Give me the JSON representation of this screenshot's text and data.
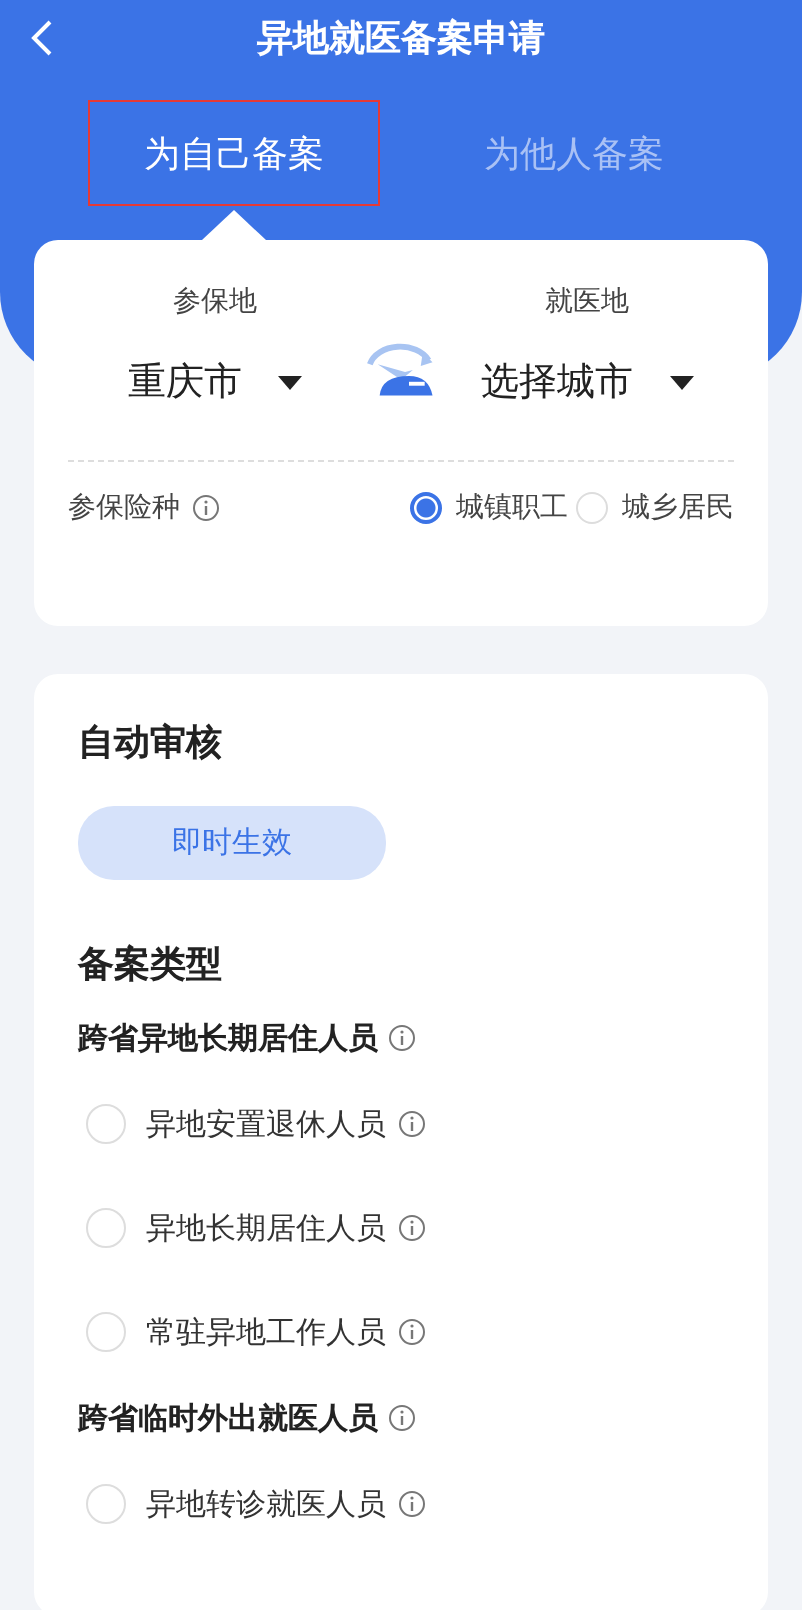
{
  "header": {
    "title": "异地就医备案申请"
  },
  "tabs": [
    {
      "label": "为自己备案",
      "selected": true,
      "highlighted": true
    },
    {
      "label": "为他人备案",
      "selected": false,
      "highlighted": false
    }
  ],
  "places": {
    "insured": {
      "label": "参保地",
      "value": "重庆市"
    },
    "treatment": {
      "label": "就医地",
      "value": "选择城市"
    }
  },
  "insurance_type": {
    "label": "参保险种",
    "options": [
      {
        "label": "城镇职工",
        "selected": true
      },
      {
        "label": "城乡居民",
        "selected": false
      }
    ]
  },
  "auto_review": {
    "title": "自动审核",
    "tag": "即时生效"
  },
  "filing_type": {
    "title": "备案类型",
    "groups": [
      {
        "title": "跨省异地长期居住人员",
        "options": [
          {
            "label": "异地安置退休人员",
            "selected": false
          },
          {
            "label": "异地长期居住人员",
            "selected": false
          },
          {
            "label": "常驻异地工作人员",
            "selected": false
          }
        ]
      },
      {
        "title": "跨省临时外出就医人员",
        "options": [
          {
            "label": "异地转诊就医人员",
            "selected": false
          }
        ]
      }
    ]
  }
}
